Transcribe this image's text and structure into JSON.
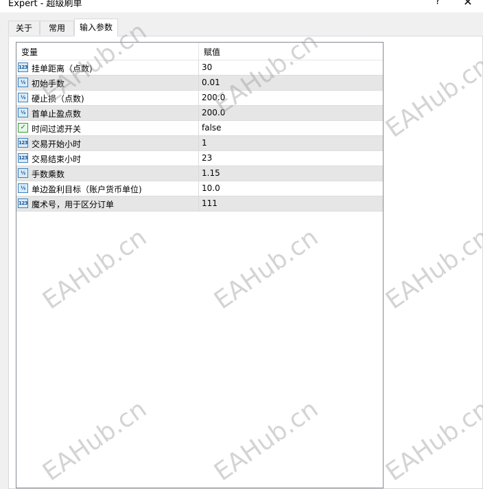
{
  "window": {
    "title": "Expert - 超级刷单",
    "help_label": "?",
    "close_label": "✕"
  },
  "tabs": [
    {
      "label": "关于"
    },
    {
      "label": "常用"
    },
    {
      "label": "输入参数",
      "active": true
    }
  ],
  "grid": {
    "headers": {
      "variable": "变量",
      "value": "赋值"
    },
    "rows": [
      {
        "icon": "int-icon",
        "icon_text": "123",
        "name": "挂单距离（点数)",
        "value": "30"
      },
      {
        "icon": "double-icon",
        "icon_text": "½",
        "name": "初始手数",
        "value": "0.01"
      },
      {
        "icon": "double-icon",
        "icon_text": "½",
        "name": "硬止损（点数)",
        "value": "200.0"
      },
      {
        "icon": "double-icon",
        "icon_text": "½",
        "name": "首单止盈点数",
        "value": "200.0"
      },
      {
        "icon": "bool-icon",
        "icon_text": "✓",
        "name": "时间过滤开关",
        "value": "false"
      },
      {
        "icon": "int-icon",
        "icon_text": "123",
        "name": "交易开始小时",
        "value": "1"
      },
      {
        "icon": "int-icon",
        "icon_text": "123",
        "name": "交易结束小时",
        "value": "23"
      },
      {
        "icon": "double-icon",
        "icon_text": "½",
        "name": "手数乘数",
        "value": "1.15"
      },
      {
        "icon": "double-icon",
        "icon_text": "½",
        "name": "单边盈利目标（账户货币单位)",
        "value": "10.0"
      },
      {
        "icon": "int-icon",
        "icon_text": "123",
        "name": "魔术号，用于区分订单",
        "value": "111"
      }
    ]
  },
  "watermark": "EAHub.cn"
}
